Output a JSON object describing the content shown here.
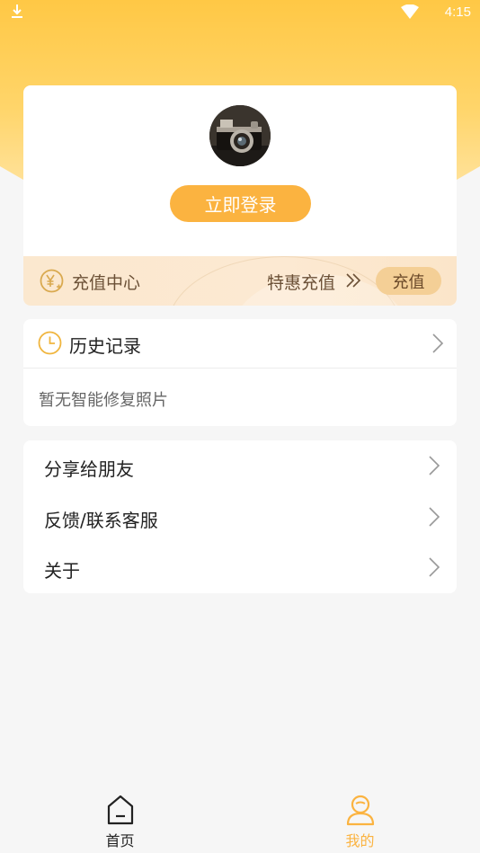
{
  "status_bar": {
    "time": "4:15"
  },
  "profile": {
    "login_label": "立即登录"
  },
  "recharge": {
    "title": "充值中心",
    "special_label": "特惠充值",
    "button_label": "充值"
  },
  "history": {
    "title": "历史记录",
    "empty_text": "暂无智能修复照片"
  },
  "menu": {
    "items": [
      {
        "label": "分享给朋友"
      },
      {
        "label": "反馈/联系客服"
      },
      {
        "label": "关于"
      }
    ]
  },
  "tabbar": {
    "tabs": [
      {
        "label": "首页",
        "icon": "home-icon",
        "active": false
      },
      {
        "label": "我的",
        "icon": "profile-icon",
        "active": true
      }
    ]
  },
  "colors": {
    "accent": "#fbb340",
    "header_yellow": "#ffc845",
    "recharge_text": "#6b5036",
    "active_tab": "#fbb340",
    "inactive_tab": "#222222"
  }
}
